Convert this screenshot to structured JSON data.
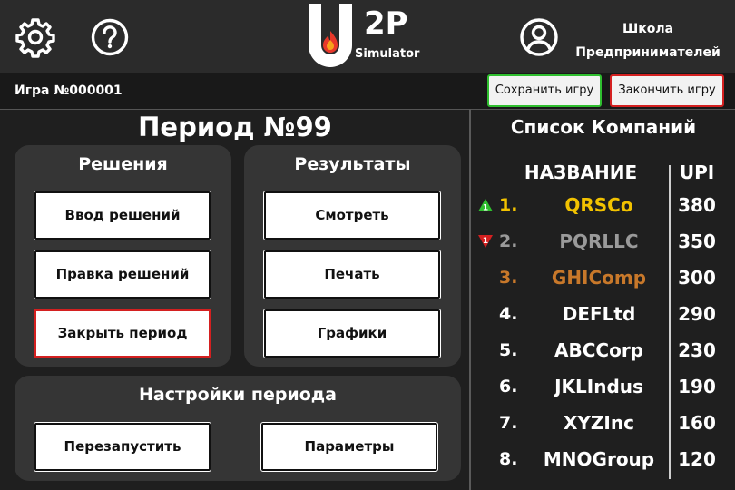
{
  "header": {
    "settings_icon": "gear-icon",
    "help_icon": "question-icon",
    "logo_text": "2P",
    "logo_subtext": "Simulator",
    "user_icon": "user-icon",
    "school_line1": "Школа",
    "school_line2": "Предпринимателей"
  },
  "subheader": {
    "game_id": "Игра №000001",
    "save_label": "Сохранить игру",
    "end_label": "Закончить игру"
  },
  "main": {
    "period_title": "Период №99",
    "decisions": {
      "title": "Решения",
      "enter": "Ввод решений",
      "edit": "Правка решений",
      "close": "Закрыть период"
    },
    "results": {
      "title": "Результаты",
      "view": "Смотреть",
      "print": "Печать",
      "charts": "Графики"
    },
    "settings": {
      "title": "Настройки периода",
      "restart": "Перезапустить",
      "params": "Параметры"
    }
  },
  "companies": {
    "title": "Список Компаний",
    "col_name": "НАЗВАНИЕ",
    "col_upi": "UPI",
    "rows": [
      {
        "rank": "1.",
        "name": "QRSCo",
        "upi": "380",
        "color": "#f2c200",
        "trend": "up",
        "trend_value": "1"
      },
      {
        "rank": "2.",
        "name": "PQRLLC",
        "upi": "350",
        "color": "#9a9a9a",
        "trend": "down",
        "trend_value": "1"
      },
      {
        "rank": "3.",
        "name": "GHIComp",
        "upi": "300",
        "color": "#c8782a",
        "trend": "",
        "trend_value": ""
      },
      {
        "rank": "4.",
        "name": "DEFLtd",
        "upi": "290",
        "color": "#ffffff",
        "trend": "",
        "trend_value": ""
      },
      {
        "rank": "5.",
        "name": "ABCCorp",
        "upi": "230",
        "color": "#ffffff",
        "trend": "",
        "trend_value": ""
      },
      {
        "rank": "6.",
        "name": "JKLIndus",
        "upi": "190",
        "color": "#ffffff",
        "trend": "",
        "trend_value": ""
      },
      {
        "rank": "7.",
        "name": "XYZInc",
        "upi": "160",
        "color": "#ffffff",
        "trend": "",
        "trend_value": ""
      },
      {
        "rank": "8.",
        "name": "MNOGroup",
        "upi": "120",
        "color": "#ffffff",
        "trend": "",
        "trend_value": ""
      }
    ]
  },
  "colors": {
    "save_border": "#2fbf2f",
    "end_border": "#d42020",
    "trend_up": "#2fbf2f",
    "trend_down": "#d42020"
  }
}
